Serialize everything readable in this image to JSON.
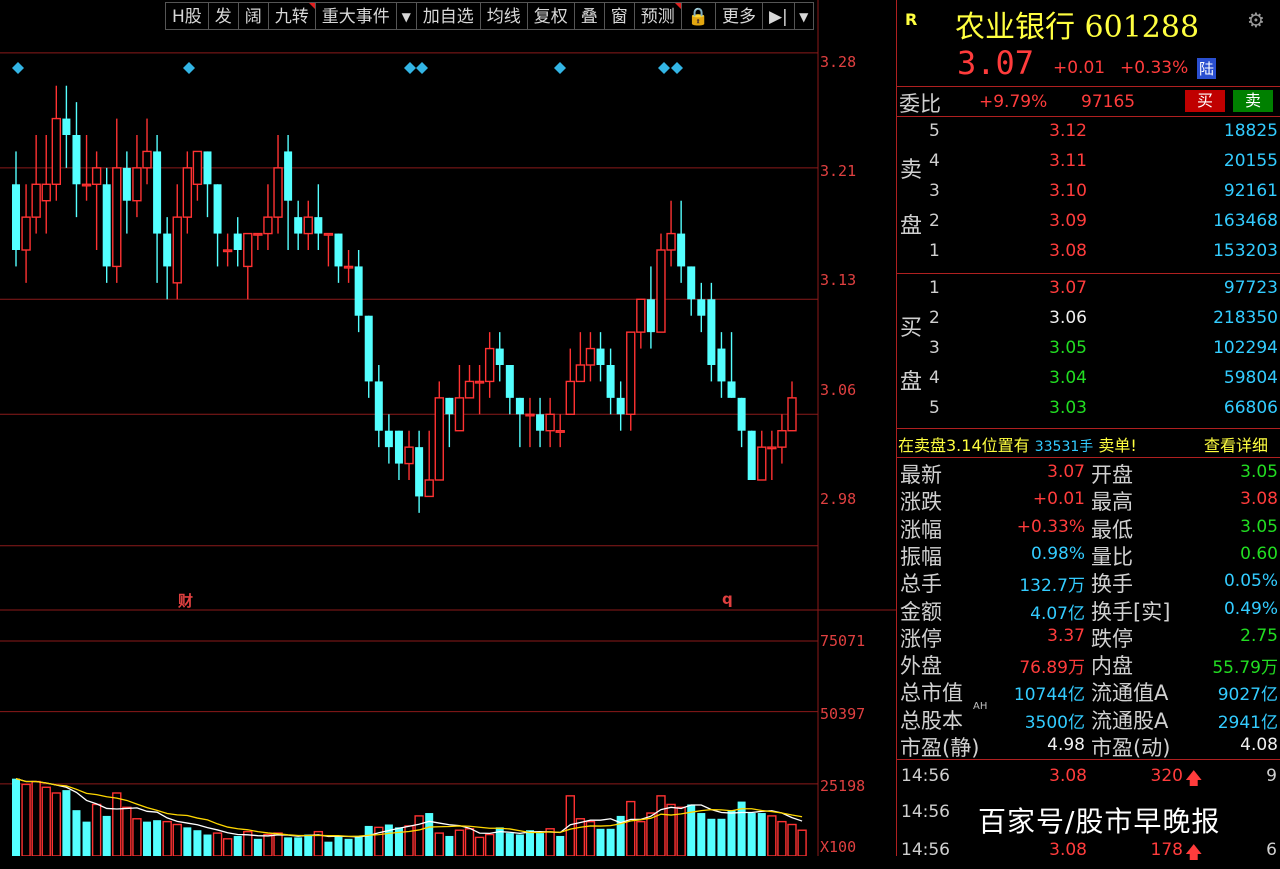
{
  "toolbar": {
    "buttons": [
      "H股",
      "发",
      "阔",
      "九转",
      "重大事件",
      "▼",
      "加自选",
      "均线",
      "复权",
      "叠",
      "窗",
      "预测",
      "🔒",
      "更多",
      "▶|",
      "▼"
    ]
  },
  "chart_data": {
    "type": "candlestick",
    "y_axis_ticks": [
      "3.28",
      "3.21",
      "3.13",
      "3.06",
      "2.98"
    ],
    "volume_axis_ticks": [
      "75071",
      "50397",
      "25198",
      "X100"
    ],
    "markers": [
      "财",
      "q"
    ],
    "candles": [
      {
        "o": 3.2,
        "c": 3.16,
        "h": 3.22,
        "l": 3.15
      },
      {
        "o": 3.16,
        "c": 3.18,
        "h": 3.2,
        "l": 3.14
      },
      {
        "o": 3.18,
        "c": 3.2,
        "h": 3.23,
        "l": 3.17
      },
      {
        "o": 3.19,
        "c": 3.2,
        "h": 3.23,
        "l": 3.17
      },
      {
        "o": 3.2,
        "c": 3.24,
        "h": 3.26,
        "l": 3.19
      },
      {
        "o": 3.24,
        "c": 3.23,
        "h": 3.26,
        "l": 3.21
      },
      {
        "o": 3.23,
        "c": 3.2,
        "h": 3.25,
        "l": 3.18
      },
      {
        "o": 3.2,
        "c": 3.2,
        "h": 3.23,
        "l": 3.19
      },
      {
        "o": 3.2,
        "c": 3.21,
        "h": 3.22,
        "l": 3.16
      },
      {
        "o": 3.2,
        "c": 3.15,
        "h": 3.21,
        "l": 3.14
      },
      {
        "o": 3.15,
        "c": 3.21,
        "h": 3.24,
        "l": 3.14
      },
      {
        "o": 3.21,
        "c": 3.19,
        "h": 3.22,
        "l": 3.17
      },
      {
        "o": 3.19,
        "c": 3.21,
        "h": 3.23,
        "l": 3.18
      },
      {
        "o": 3.21,
        "c": 3.22,
        "h": 3.24,
        "l": 3.2
      },
      {
        "o": 3.22,
        "c": 3.17,
        "h": 3.23,
        "l": 3.14
      },
      {
        "o": 3.17,
        "c": 3.15,
        "h": 3.18,
        "l": 3.13
      },
      {
        "o": 3.14,
        "c": 3.18,
        "h": 3.2,
        "l": 3.13
      },
      {
        "o": 3.18,
        "c": 3.21,
        "h": 3.22,
        "l": 3.17
      },
      {
        "o": 3.2,
        "c": 3.22,
        "h": 3.22,
        "l": 3.19
      },
      {
        "o": 3.22,
        "c": 3.2,
        "h": 3.22,
        "l": 3.18
      },
      {
        "o": 3.2,
        "c": 3.17,
        "h": 3.2,
        "l": 3.15
      },
      {
        "o": 3.16,
        "c": 3.16,
        "h": 3.17,
        "l": 3.15
      },
      {
        "o": 3.17,
        "c": 3.16,
        "h": 3.18,
        "l": 3.15
      },
      {
        "o": 3.15,
        "c": 3.17,
        "h": 3.17,
        "l": 3.13
      },
      {
        "o": 3.17,
        "c": 3.17,
        "h": 3.17,
        "l": 3.16
      },
      {
        "o": 3.17,
        "c": 3.18,
        "h": 3.2,
        "l": 3.16
      },
      {
        "o": 3.18,
        "c": 3.21,
        "h": 3.23,
        "l": 3.17
      },
      {
        "o": 3.22,
        "c": 3.19,
        "h": 3.23,
        "l": 3.16
      },
      {
        "o": 3.18,
        "c": 3.17,
        "h": 3.19,
        "l": 3.16
      },
      {
        "o": 3.17,
        "c": 3.18,
        "h": 3.19,
        "l": 3.16
      },
      {
        "o": 3.18,
        "c": 3.17,
        "h": 3.2,
        "l": 3.16
      },
      {
        "o": 3.17,
        "c": 3.17,
        "h": 3.17,
        "l": 3.15
      },
      {
        "o": 3.17,
        "c": 3.15,
        "h": 3.17,
        "l": 3.14
      },
      {
        "o": 3.15,
        "c": 3.15,
        "h": 3.16,
        "l": 3.14
      },
      {
        "o": 3.15,
        "c": 3.12,
        "h": 3.16,
        "l": 3.11
      },
      {
        "o": 3.12,
        "c": 3.08,
        "h": 3.12,
        "l": 3.07
      },
      {
        "o": 3.08,
        "c": 3.05,
        "h": 3.09,
        "l": 3.04
      },
      {
        "o": 3.05,
        "c": 3.04,
        "h": 3.06,
        "l": 3.03
      },
      {
        "o": 3.05,
        "c": 3.03,
        "h": 3.05,
        "l": 3.02
      },
      {
        "o": 3.03,
        "c": 3.04,
        "h": 3.05,
        "l": 3.02
      },
      {
        "o": 3.04,
        "c": 3.01,
        "h": 3.05,
        "l": 3.0
      },
      {
        "o": 3.01,
        "c": 3.02,
        "h": 3.05,
        "l": 3.01
      },
      {
        "o": 3.02,
        "c": 3.07,
        "h": 3.08,
        "l": 3.02
      },
      {
        "o": 3.07,
        "c": 3.06,
        "h": 3.07,
        "l": 3.04
      },
      {
        "o": 3.05,
        "c": 3.07,
        "h": 3.09,
        "l": 3.05
      },
      {
        "o": 3.07,
        "c": 3.08,
        "h": 3.09,
        "l": 3.07
      },
      {
        "o": 3.08,
        "c": 3.08,
        "h": 3.09,
        "l": 3.06
      },
      {
        "o": 3.08,
        "c": 3.1,
        "h": 3.11,
        "l": 3.07
      },
      {
        "o": 3.1,
        "c": 3.09,
        "h": 3.11,
        "l": 3.08
      },
      {
        "o": 3.09,
        "c": 3.07,
        "h": 3.09,
        "l": 3.06
      },
      {
        "o": 3.07,
        "c": 3.06,
        "h": 3.07,
        "l": 3.04
      },
      {
        "o": 3.06,
        "c": 3.06,
        "h": 3.07,
        "l": 3.04
      },
      {
        "o": 3.06,
        "c": 3.05,
        "h": 3.07,
        "l": 3.04
      },
      {
        "o": 3.05,
        "c": 3.06,
        "h": 3.07,
        "l": 3.04
      },
      {
        "o": 3.05,
        "c": 3.05,
        "h": 3.06,
        "l": 3.04
      },
      {
        "o": 3.06,
        "c": 3.08,
        "h": 3.1,
        "l": 3.06
      },
      {
        "o": 3.08,
        "c": 3.09,
        "h": 3.11,
        "l": 3.08
      },
      {
        "o": 3.09,
        "c": 3.1,
        "h": 3.11,
        "l": 3.08
      },
      {
        "o": 3.1,
        "c": 3.09,
        "h": 3.11,
        "l": 3.08
      },
      {
        "o": 3.09,
        "c": 3.07,
        "h": 3.1,
        "l": 3.06
      },
      {
        "o": 3.07,
        "c": 3.06,
        "h": 3.08,
        "l": 3.05
      },
      {
        "o": 3.06,
        "c": 3.11,
        "h": 3.11,
        "l": 3.05
      },
      {
        "o": 3.11,
        "c": 3.13,
        "h": 3.13,
        "l": 3.1
      },
      {
        "o": 3.13,
        "c": 3.11,
        "h": 3.15,
        "l": 3.1
      },
      {
        "o": 3.11,
        "c": 3.16,
        "h": 3.17,
        "l": 3.11
      },
      {
        "o": 3.16,
        "c": 3.17,
        "h": 3.19,
        "l": 3.15
      },
      {
        "o": 3.17,
        "c": 3.15,
        "h": 3.19,
        "l": 3.14
      },
      {
        "o": 3.15,
        "c": 3.13,
        "h": 3.15,
        "l": 3.12
      },
      {
        "o": 3.13,
        "c": 3.12,
        "h": 3.14,
        "l": 3.11
      },
      {
        "o": 3.13,
        "c": 3.09,
        "h": 3.14,
        "l": 3.08
      },
      {
        "o": 3.1,
        "c": 3.08,
        "h": 3.11,
        "l": 3.07
      },
      {
        "o": 3.08,
        "c": 3.07,
        "h": 3.11,
        "l": 3.07
      },
      {
        "o": 3.07,
        "c": 3.05,
        "h": 3.07,
        "l": 3.04
      },
      {
        "o": 3.05,
        "c": 3.02,
        "h": 3.05,
        "l": 3.02
      },
      {
        "o": 3.02,
        "c": 3.04,
        "h": 3.05,
        "l": 3.02
      },
      {
        "o": 3.04,
        "c": 3.04,
        "h": 3.05,
        "l": 3.02
      },
      {
        "o": 3.04,
        "c": 3.05,
        "h": 3.06,
        "l": 3.03
      },
      {
        "o": 3.05,
        "c": 3.07,
        "h": 3.08,
        "l": 3.05
      }
    ],
    "volumes": [
      {
        "v": 27000,
        "up": false
      },
      {
        "v": 25000,
        "up": true
      },
      {
        "v": 26000,
        "up": true
      },
      {
        "v": 24000,
        "up": true
      },
      {
        "v": 22000,
        "up": true
      },
      {
        "v": 23000,
        "up": false
      },
      {
        "v": 16000,
        "up": false
      },
      {
        "v": 12000,
        "up": false
      },
      {
        "v": 18000,
        "up": true
      },
      {
        "v": 14000,
        "up": false
      },
      {
        "v": 22000,
        "up": true
      },
      {
        "v": 17000,
        "up": true
      },
      {
        "v": 13000,
        "up": true
      },
      {
        "v": 12000,
        "up": false
      },
      {
        "v": 12500,
        "up": false
      },
      {
        "v": 12000,
        "up": true
      },
      {
        "v": 11000,
        "up": true
      },
      {
        "v": 10000,
        "up": false
      },
      {
        "v": 9000,
        "up": false
      },
      {
        "v": 7500,
        "up": false
      },
      {
        "v": 8000,
        "up": true
      },
      {
        "v": 6000,
        "up": true
      },
      {
        "v": 7000,
        "up": false
      },
      {
        "v": 8500,
        "up": true
      },
      {
        "v": 6000,
        "up": false
      },
      {
        "v": 7500,
        "up": true
      },
      {
        "v": 8000,
        "up": true
      },
      {
        "v": 6500,
        "up": false
      },
      {
        "v": 6500,
        "up": false
      },
      {
        "v": 7500,
        "up": false
      },
      {
        "v": 8500,
        "up": true
      },
      {
        "v": 5000,
        "up": false
      },
      {
        "v": 7000,
        "up": false
      },
      {
        "v": 6000,
        "up": false
      },
      {
        "v": 7000,
        "up": false
      },
      {
        "v": 10500,
        "up": false
      },
      {
        "v": 10000,
        "up": true
      },
      {
        "v": 11000,
        "up": false
      },
      {
        "v": 10000,
        "up": false
      },
      {
        "v": 10500,
        "up": true
      },
      {
        "v": 14000,
        "up": true
      },
      {
        "v": 15000,
        "up": false
      },
      {
        "v": 8000,
        "up": true
      },
      {
        "v": 7000,
        "up": false
      },
      {
        "v": 9000,
        "up": true
      },
      {
        "v": 9500,
        "up": true
      },
      {
        "v": 6500,
        "up": true
      },
      {
        "v": 7500,
        "up": true
      },
      {
        "v": 10000,
        "up": false
      },
      {
        "v": 8000,
        "up": false
      },
      {
        "v": 7500,
        "up": false
      },
      {
        "v": 9000,
        "up": false
      },
      {
        "v": 8000,
        "up": false
      },
      {
        "v": 9500,
        "up": true
      },
      {
        "v": 7000,
        "up": false
      },
      {
        "v": 21000,
        "up": true
      },
      {
        "v": 13000,
        "up": true
      },
      {
        "v": 12000,
        "up": true
      },
      {
        "v": 9500,
        "up": false
      },
      {
        "v": 9500,
        "up": false
      },
      {
        "v": 14000,
        "up": false
      },
      {
        "v": 19000,
        "up": true
      },
      {
        "v": 12000,
        "up": true
      },
      {
        "v": 15000,
        "up": true
      },
      {
        "v": 21000,
        "up": true
      },
      {
        "v": 18000,
        "up": true
      },
      {
        "v": 17000,
        "up": true
      },
      {
        "v": 18000,
        "up": false
      },
      {
        "v": 15000,
        "up": false
      },
      {
        "v": 13000,
        "up": false
      },
      {
        "v": 13000,
        "up": false
      },
      {
        "v": 16000,
        "up": false
      },
      {
        "v": 19000,
        "up": false
      },
      {
        "v": 15000,
        "up": false
      },
      {
        "v": 15000,
        "up": false
      },
      {
        "v": 14000,
        "up": true
      },
      {
        "v": 12000,
        "up": true
      },
      {
        "v": 11000,
        "up": true
      },
      {
        "v": 9000,
        "up": true
      }
    ],
    "y_range": [
      2.95,
      3.3
    ],
    "volume_range": [
      0,
      75071
    ]
  },
  "stock": {
    "r_mark": "R",
    "name_code": "农业银行 601288",
    "price": "3.07",
    "change": "+0.01",
    "pct": "+0.33%",
    "lu_badge": "陆",
    "weibi_label": "委比",
    "weibi_pct": "+9.79%",
    "weibi_val": "97165",
    "buy_btn": "买",
    "sell_btn": "卖"
  },
  "asks_label": [
    "卖",
    "盘"
  ],
  "asks": [
    {
      "lvl": "5",
      "price": "3.12",
      "vol": "18825"
    },
    {
      "lvl": "4",
      "price": "3.11",
      "vol": "20155"
    },
    {
      "lvl": "3",
      "price": "3.10",
      "vol": "92161"
    },
    {
      "lvl": "2",
      "price": "3.09",
      "vol": "163468"
    },
    {
      "lvl": "1",
      "price": "3.08",
      "vol": "153203"
    }
  ],
  "bids_label": [
    "买",
    "盘"
  ],
  "bids": [
    {
      "lvl": "1",
      "price": "3.07",
      "vol": "97723"
    },
    {
      "lvl": "2",
      "price": "3.06",
      "vol": "218350"
    },
    {
      "lvl": "3",
      "price": "3.05",
      "vol": "102294"
    },
    {
      "lvl": "4",
      "price": "3.04",
      "vol": "59804"
    },
    {
      "lvl": "5",
      "price": "3.03",
      "vol": "66806"
    }
  ],
  "alert": {
    "text1": "在卖盘3.14位置有",
    "qty": "33531手",
    "text2": "卖单!",
    "link": "查看详细"
  },
  "stats": [
    {
      "l1": "最新",
      "v1": "3.07",
      "c1": "red",
      "l2": "开盘",
      "v2": "3.05",
      "c2": "green"
    },
    {
      "l1": "涨跌",
      "v1": "+0.01",
      "c1": "red",
      "l2": "最高",
      "v2": "3.08",
      "c2": "red"
    },
    {
      "l1": "涨幅",
      "v1": "+0.33%",
      "c1": "red",
      "l2": "最低",
      "v2": "3.05",
      "c2": "green"
    },
    {
      "l1": "振幅",
      "v1": "0.98%",
      "c1": "cyan",
      "l2": "量比",
      "v2": "0.60",
      "c2": "green"
    },
    {
      "l1": "总手",
      "v1": "132.7万",
      "c1": "cyan",
      "l2": "换手",
      "v2": "0.05%",
      "c2": "cyan"
    },
    {
      "l1": "金额",
      "v1": "4.07亿",
      "c1": "cyan",
      "l2": "换手[实]",
      "v2": "0.49%",
      "c2": "cyan"
    },
    {
      "l1": "涨停",
      "v1": "3.37",
      "c1": "red",
      "l2": "跌停",
      "v2": "2.75",
      "c2": "green"
    },
    {
      "l1": "外盘",
      "v1": "76.89万",
      "c1": "red",
      "l2": "内盘",
      "v2": "55.79万",
      "c2": "green"
    },
    {
      "l1": "总市值",
      "v1": "10744亿",
      "c1": "cyan",
      "l2": "流通值A",
      "v2": "9027亿",
      "c2": "cyan"
    },
    {
      "l1": "总股本",
      "v1": "3500亿",
      "c1": "cyan",
      "l2": "流通股A",
      "v2": "2941亿",
      "c2": "cyan"
    },
    {
      "l1": "市盈(静)",
      "v1": "4.98",
      "c1": "white",
      "l2": "市盈(动)",
      "v2": "4.08",
      "c2": "white"
    }
  ],
  "stats_sup": "AH",
  "ticks": [
    {
      "time": "14:56",
      "price": "3.08",
      "vol": "320",
      "dir": "up",
      "n": "9"
    },
    {
      "time": "14:56",
      "price": "",
      "vol": "",
      "dir": "",
      "n": ""
    },
    {
      "time": "14:56",
      "price": "3.08",
      "vol": "178",
      "dir": "up",
      "n": "6"
    }
  ],
  "watermark": "百家号/股市早晚报",
  "colors": {
    "up": "#ff3232",
    "down": "#54ffff",
    "grid": "#8b1a1a",
    "ma1": "#ffffff",
    "ma2": "#ffd700"
  }
}
